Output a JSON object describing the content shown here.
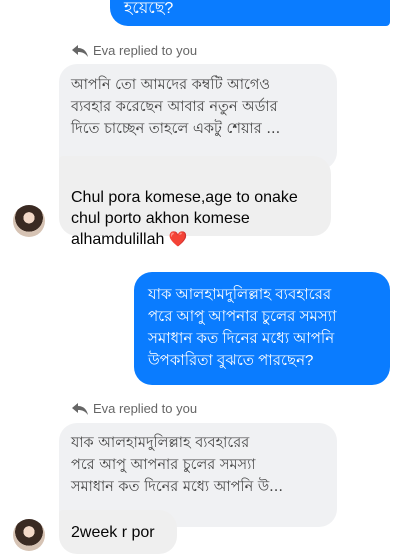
{
  "messages": {
    "top_outgoing_tail": "হয়েছে?",
    "reply1": {
      "replied_label": "Eva replied to you",
      "quoted_text": "আপনি তো আমদের কম্বটি আগেও\nব্যবহার করেছেন আবার নতুন অর্ডার\nদিতে চাচ্ছেন তাহলে একটু শেয়ার ...",
      "reply_text": "Chul pora komese,age to onake\nchul porto akhon komese\nalhamdulillah",
      "reply_emoji": "❤️"
    },
    "outgoing2": {
      "text": "যাক আলহামদুলিল্লাহ ব্যবহারের\nপরে আপু আপনার  চুলের সমস্যা\nসমাধান কত দিনের মধ্যে আপনি\nউপকারিতা বুঝতে পারছেন?"
    },
    "reply2": {
      "replied_label": "Eva replied to you",
      "quoted_text": "যাক আলহামদুলিল্লাহ ব্যবহারের\nপরে আপু আপনার  চুলের সমস্যা\nসমাধান কত দিনের মধ্যে আপনি উ...",
      "reply_text": "2week r por"
    }
  },
  "colors": {
    "outgoing_bubble": "#0a7cff",
    "incoming_bubble": "#efefef",
    "quote_bubble": "#f0f1f3"
  }
}
